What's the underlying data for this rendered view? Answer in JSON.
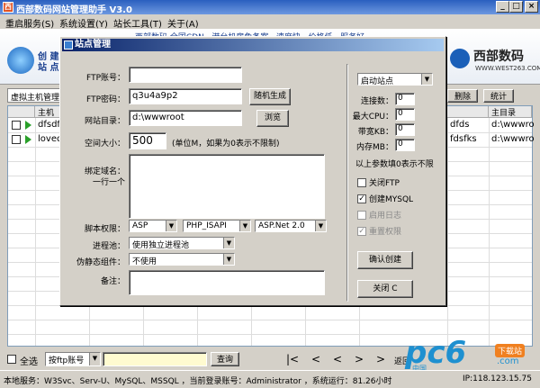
{
  "window": {
    "title": "西部数码网站管理助手 V3.0",
    "min": "_",
    "max": "□",
    "close": "×"
  },
  "menu": [
    "重启服务(S)",
    "系统设置(Y)",
    "站长工具(T)",
    "关于(A)"
  ],
  "banner": {
    "left_text_1": "创 建",
    "left_text_2": "站 点",
    "marquee": "西部数码 全国CDN · 港台机房免备案 · 速度快 · 价格低 · 服务好",
    "logo_text": "西部数码",
    "logo_url": "WWW.WEST263.COM"
  },
  "tab": {
    "label": "虚拟主机管理"
  },
  "toolbar": {
    "delete": "删除",
    "stats": "统计"
  },
  "grid": {
    "headers": {
      "host": "主机",
      "dir": "主目录"
    },
    "rows": [
      {
        "host": "dfsdfs",
        "right": "dfds",
        "dir": "d:\\wwwro"
      },
      {
        "host": "lovedo",
        "right": "fdsfks",
        "dir": "d:\\wwwro"
      }
    ]
  },
  "bottom": {
    "select_all": "全选",
    "search_type": "按ftp账号",
    "search_btn": "查询",
    "nav": [
      "|<",
      "<",
      "<",
      ">",
      ">",
      ">|"
    ],
    "back": "返回"
  },
  "status": {
    "text": "本地服务：W3Svc、Serv-U、MySQL、MSSQL ，当前登录账号：Administrator ，系统运行：81.26小时",
    "ip": "IP:118.123.15.75"
  },
  "watermark": {
    "text": "pc6",
    "sub": ".com",
    "dl": "下载站",
    "cn": "中国"
  },
  "dialog": {
    "title": "站点管理",
    "ftp_account_label": "FTP账号：",
    "ftp_account_value": "",
    "ftp_pass_label": "FTP密码：",
    "ftp_pass_value": "q3u4a9p2",
    "random_btn": "随机生成",
    "dir_label": "网站目录：",
    "dir_value": "d:\\wwwroot",
    "browse_btn": "浏览",
    "space_label": "空间大小：",
    "space_value": "500",
    "space_note": "(单位M，如果为0表示不限制)",
    "domain_label_1": "绑定域名：",
    "domain_label_2": "一行一个",
    "domain_value": "",
    "script_label": "脚本权限：",
    "script_asp": "ASP",
    "script_php": "PHP_ISAPI",
    "script_net": "ASP.Net 2.0",
    "pool_label": "进程池：",
    "pool_value": "使用独立进程池",
    "rewrite_label": "伪静态组件：",
    "rewrite_value": "不使用",
    "remark_label": "备注：",
    "remark_value": "",
    "start_site": "启动站点",
    "conn_label": "连接数：",
    "conn_value": "0",
    "cpu_label": "最大CPU：",
    "cpu_value": "0",
    "bw_label": "带宽KB：",
    "bw_value": "0",
    "mem_label": "内存MB：",
    "mem_value": "0",
    "limit_note": "以上参数填0表示不限",
    "close_ftp": "关闭FTP",
    "create_mysql": "创建MYSQL",
    "enable_log": "启用日志",
    "reset_perm": "重置权限",
    "confirm_btn": "确认创建",
    "close_btn": "关闭 C"
  },
  "colors": {
    "title": "#2a5fbf",
    "dialog_title": "#0a246a",
    "watermark": "#1e90d0"
  }
}
